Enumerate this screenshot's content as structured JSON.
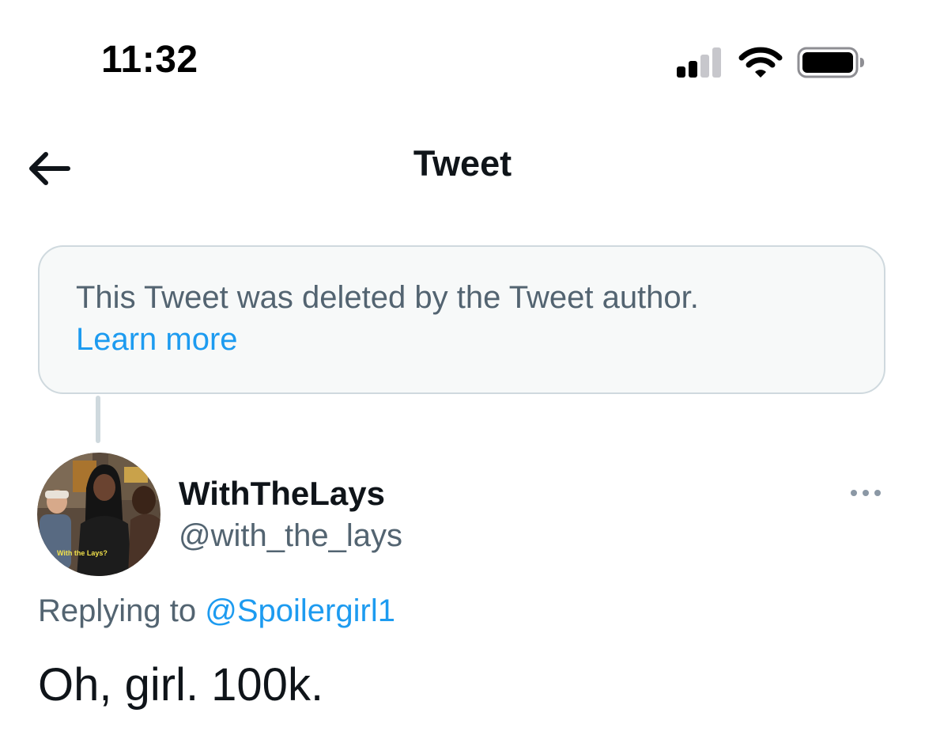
{
  "status_bar": {
    "time": "11:32",
    "icons": [
      "cellular-signal-icon",
      "wifi-icon",
      "battery-icon"
    ]
  },
  "header": {
    "back_icon": "back-arrow-icon",
    "title": "Tweet"
  },
  "deleted_notice": {
    "text": "This Tweet was deleted by the Tweet author.",
    "link": "Learn more"
  },
  "tweet": {
    "author": {
      "display_name": "WithTheLays",
      "handle": "@with_the_lays",
      "avatar_caption": "With the Lays?"
    },
    "more_icon": "more-options-icon",
    "replying_prefix": "Replying to",
    "replying_to": "@Spoilergirl1",
    "text": "Oh, girl. 100k."
  },
  "colors": {
    "text_primary": "#0f1419",
    "text_secondary": "#536471",
    "link": "#1d9bf0",
    "notice_bg": "#f7f9f9",
    "border": "#cfd9de"
  }
}
